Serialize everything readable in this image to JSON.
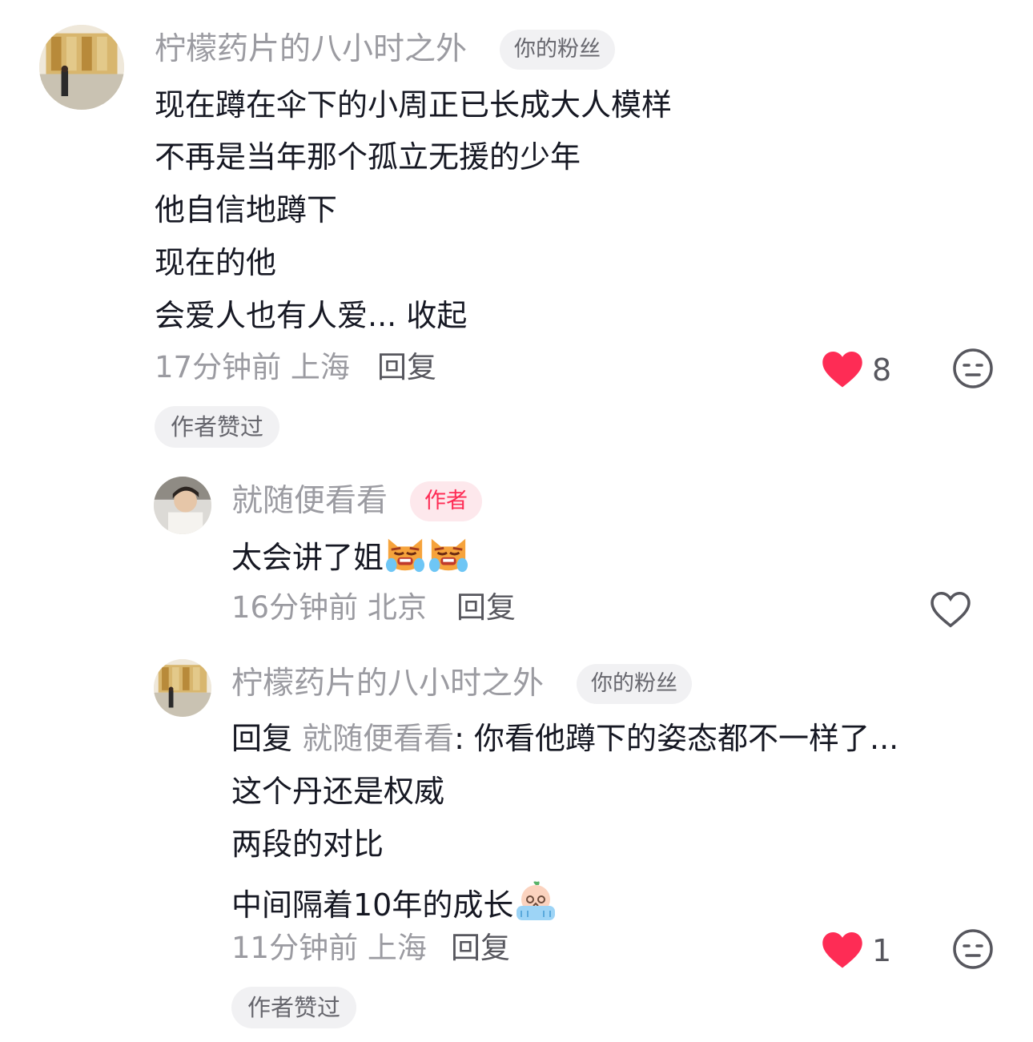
{
  "comment1": {
    "username": "柠檬药片的八小时之外",
    "badge": "你的粉丝",
    "lines": [
      "现在蹲在伞下的小周正已长成大人模样",
      "不再是当年那个孤立无援的少年",
      "他自信地蹲下",
      "现在的他",
      "会爱人也有人爱..."
    ],
    "collapse_label": "收起",
    "time": "17分钟前",
    "location": "上海",
    "reply_label": "回复",
    "like_count": "8",
    "liked_by_author_label": "作者赞过",
    "colors": {
      "heart": "#fe2c55"
    }
  },
  "reply1": {
    "username": "就随便看看",
    "badge": "作者",
    "text": "太会讲了姐",
    "emojis": [
      "crying-cat-emoji",
      "crying-cat-emoji"
    ],
    "time": "16分钟前",
    "location": "北京",
    "reply_label": "回复"
  },
  "reply2": {
    "username": "柠檬药片的八小时之外",
    "badge": "你的粉丝",
    "reply_prefix": "回复",
    "reply_to": "就随便看看",
    "first_line_rest": ": 你看他蹲下的姿态都不一样了...",
    "lines": [
      "这个丹还是权威",
      "两段的对比",
      "中间隔着10年的成长"
    ],
    "trailing_emoji": "sobbing-peach-emoji",
    "time": "11分钟前",
    "location": "上海",
    "reply_label": "回复",
    "like_count": "1",
    "liked_by_author_label": "作者赞过"
  }
}
